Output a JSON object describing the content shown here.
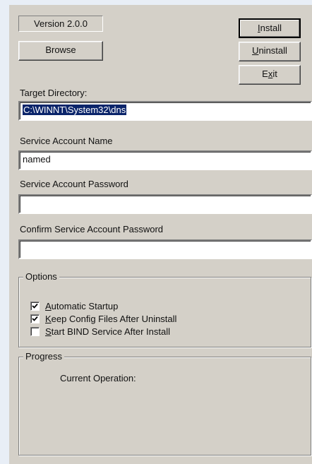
{
  "version": "Version 2.0.0",
  "buttons": {
    "browse": "Browse",
    "install_mnemonic": "I",
    "install_rest": "nstall",
    "uninstall_mnemonic": "U",
    "uninstall_rest": "ninstall",
    "exit_pre": "E",
    "exit_mnemonic": "x",
    "exit_rest": "it"
  },
  "target_directory": {
    "label": "Target Directory:",
    "value": "C:\\WINNT\\System32\\dns"
  },
  "service_account_name": {
    "label": "Service Account Name",
    "value": "named"
  },
  "service_account_password": {
    "label": "Service Account Password",
    "value": ""
  },
  "confirm_password": {
    "label": "Confirm Service Account Password",
    "value": ""
  },
  "options": {
    "title": "Options",
    "items": [
      {
        "mnemonic": "A",
        "rest": "utomatic Startup",
        "checked": true
      },
      {
        "mnemonic": "K",
        "rest": "eep Config Files After Uninstall",
        "checked": true
      },
      {
        "mnemonic": "S",
        "rest": "tart BIND Service After Install",
        "checked": false
      }
    ]
  },
  "progress": {
    "title": "Progress",
    "current_operation_label": "Current Operation:"
  }
}
